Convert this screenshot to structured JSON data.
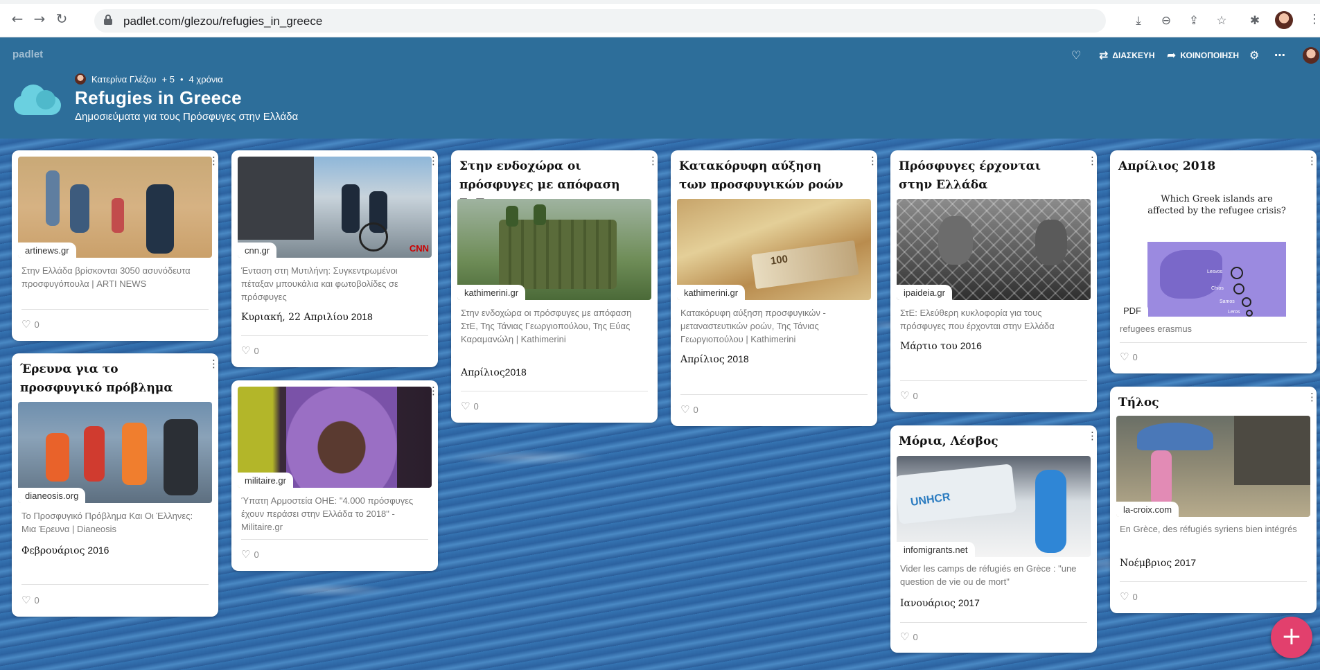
{
  "browser": {
    "url": "padlet.com/glezou/refugies_in_greece",
    "back_icon": "arrow-left-icon",
    "forward_icon": "arrow-right-icon",
    "reload_icon": "reload-icon"
  },
  "header": {
    "brand": "padlet",
    "author": "Κατερίνα Γλέζου",
    "plus_count": "+ 5",
    "separator": "•",
    "age": "4 χρόνια",
    "title": "Refugies in Greece",
    "subtitle": "Δημοσιεύματα για τους Πρόσφυγες στην Ελλάδα",
    "actions": {
      "remix": "ΔΙΑΣΚΕΥΗ",
      "share": "ΚΟΙΝΟΠΟΙΗΣΗ"
    }
  },
  "cards": [
    {
      "title": "",
      "source": "artinews.gr",
      "body": "Στην Ελλάδα βρίσκονται 3050 ασυνόδευτα προσφυγόπουλα | ARTI NEWS",
      "date_month": "",
      "date_rest": "",
      "likes": "0"
    },
    {
      "title": "",
      "source": "cnn.gr",
      "body": "Ένταση στη Μυτιλήνη: Συγκεντρωμένοι πέταξαν μπουκάλια και φωτοβολίδες σε πρόσφυγες",
      "date_month": "Κυριακή, 22 Απριλίου",
      "date_rest": " 2018",
      "likes": "0"
    },
    {
      "title": "Στην ενδοχώρα οι πρόσφυγες με απόφαση ΣτΕ",
      "source": "kathimerini.gr",
      "body": "Στην ενδοχώρα οι πρόσφυγες με απόφαση ΣτΕ, Της Τάνιας Γεωργιοπούλου, Της Εύας Καραμανώλη | Kathimerini",
      "date_month": "Απρίλιος",
      "date_rest": "2018",
      "likes": "0"
    },
    {
      "title": "Κατακόρυφη αύξηση των προσφυγικών ροών",
      "source": "kathimerini.gr",
      "body": "Κατακόρυφη αύξηση προσφυγικών - μεταναστευτικών ροών, Της Τάνιας Γεωργιοπούλου | Kathimerini",
      "date_month": "Απρίλιος",
      "date_rest": " 2018",
      "likes": "0"
    },
    {
      "title": "Πρόσφυγες έρχονται στην Ελλάδα",
      "source": "ipaideia.gr",
      "body": "ΣτΕ: Ελεύθερη κυκλοφορία για τους πρόσφυγες που έρχονται στην Ελλάδα",
      "date_month": "Μάρτιο του",
      "date_rest": " 2016",
      "likes": "0"
    },
    {
      "title": "Απρίλιος 2018",
      "source": "PDF",
      "body": "refugees erasmus",
      "date_month": "",
      "date_rest": "",
      "likes": "0",
      "pdf_heading": "Which Greek islands are affected by the refugee crisis?",
      "pdf_labels": [
        "Lesvos",
        "Chios",
        "Samos",
        "Leros"
      ]
    },
    {
      "title": "Έρευνα για το προσφυγικό πρόβλημα",
      "source": "dianeosis.org",
      "body": "Το Προσφυγικό Πρόβλημα Και Οι Έλληνες: Μια Έρευνα | Dianeosis",
      "date_month": "Φεβρουάριος",
      "date_rest": " 2016",
      "likes": "0"
    },
    {
      "title": "",
      "source": "militaire.gr",
      "body": "Ύπατη Αρμοστεία ΟΗΕ: \"4.000 πρόσφυγες έχουν περάσει στην Ελλάδα το 2018\" - Militaire.gr",
      "date_month": "",
      "date_rest": "",
      "likes": "0"
    },
    {
      "title": "Μόρια, Λέσβος",
      "source": "infomigrants.net",
      "body": "Vider les camps de réfugiés en Grèce : \"une question de vie ou de mort\"",
      "date_month": "Ιανουάριος",
      "date_rest": " 2017",
      "likes": "0"
    },
    {
      "title": "Τήλος",
      "source": "la-croix.com",
      "body": "En Grèce, des réfugiés syriens bien intégrés",
      "date_month": "Νοέμβριος",
      "date_rest": " 2017",
      "likes": "0"
    }
  ],
  "fab_label": "+",
  "colors": {
    "header": "#2d6e9a",
    "fab": "#e2406d",
    "card": "#ffffff"
  }
}
